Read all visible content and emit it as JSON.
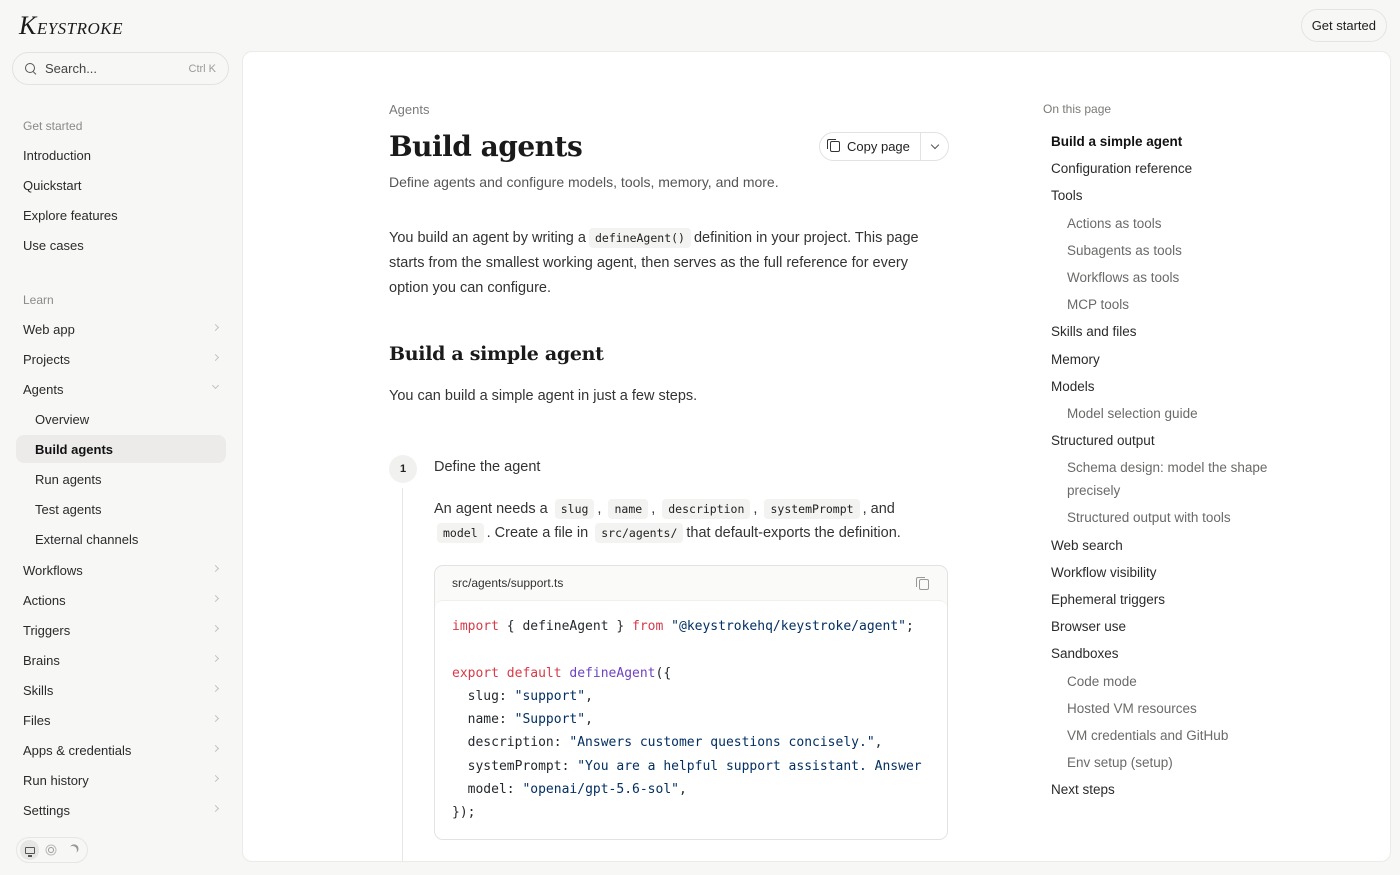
{
  "header": {
    "logo_initial": "K",
    "logo_rest": "EYSTROKE",
    "get_started": "Get started"
  },
  "sidebar": {
    "search_placeholder": "Search...",
    "search_shortcut": "Ctrl K",
    "section_get_started": "Get started",
    "get_started_items": [
      "Introduction",
      "Quickstart",
      "Explore features",
      "Use cases"
    ],
    "section_learn": "Learn",
    "learn_items": [
      "Web app",
      "Projects",
      "Agents"
    ],
    "agents_children": [
      "Overview",
      "Build agents",
      "Run agents",
      "Test agents",
      "External channels"
    ],
    "active_item": "Build agents",
    "more_items": [
      "Workflows",
      "Actions",
      "Triggers",
      "Brains",
      "Skills",
      "Files",
      "Apps & credentials",
      "Run history",
      "Settings"
    ],
    "theme_options": [
      "monitor-icon",
      "sun-icon",
      "moon-icon"
    ],
    "theme_selected": "monitor-icon"
  },
  "page": {
    "breadcrumb": "Agents",
    "title": "Build agents",
    "copy_page_label": "Copy page",
    "subtitle": "Define agents and configure models, tools, memory, and more.",
    "intro_before": "You build an agent by writing a",
    "intro_code": "defineAgent()",
    "intro_after": "definition in your project. This page starts from the smallest working agent, then serves as the full reference for every option you can configure.",
    "h2_simple": "Build a simple agent",
    "simple_para": "You can build a simple agent in just a few steps.",
    "step1": {
      "number": "1",
      "title": "Define the agent",
      "t1": "An agent needs a",
      "c_slug": "slug",
      "sep1": ",",
      "c_name": "name",
      "sep2": ",",
      "c_description": "description",
      "sep3": ",",
      "c_systemPrompt": "systemPrompt",
      "t2": ", and",
      "c_model": "model",
      "t3": ". Create a file in",
      "c_path": "src/agents/",
      "t4": "that default-exports the definition."
    },
    "code": {
      "filename": "src/agents/support.ts",
      "l1_kw1": "import",
      "l1_mid": " { defineAgent } ",
      "l1_kw2": "from",
      "l1_str": " \"@keystrokehq/keystroke/agent\"",
      "l1_end": ";",
      "l3_kw": "export default",
      "l3_fn": " defineAgent",
      "l3_end": "({",
      "l4_key": "  slug: ",
      "l4_val": "\"support\"",
      "l5_key": "  name: ",
      "l5_val": "\"Support\"",
      "l6_key": "  description: ",
      "l6_val": "\"Answers customer questions concisely.\"",
      "l7_key": "  systemPrompt: ",
      "l7_val": "\"You are a helpful support assistant. Answer",
      "l8_key": "  model: ",
      "l8_val": "\"openai/gpt-5.6-sol\"",
      "comma": ",",
      "l9": "});"
    }
  },
  "toc": {
    "label": "On this page",
    "active": "Build a simple agent",
    "items": [
      {
        "text": "Build a simple agent",
        "level": 1
      },
      {
        "text": "Configuration reference",
        "level": 1
      },
      {
        "text": "Tools",
        "level": 1
      },
      {
        "text": "Actions as tools",
        "level": 2
      },
      {
        "text": "Subagents as tools",
        "level": 2
      },
      {
        "text": "Workflows as tools",
        "level": 2
      },
      {
        "text": "MCP tools",
        "level": 2
      },
      {
        "text": "Skills and files",
        "level": 1
      },
      {
        "text": "Memory",
        "level": 1
      },
      {
        "text": "Models",
        "level": 1
      },
      {
        "text": "Model selection guide",
        "level": 2
      },
      {
        "text": "Structured output",
        "level": 1
      },
      {
        "text": "Schema design: model the shape precisely",
        "level": 2
      },
      {
        "text": "Structured output with tools",
        "level": 2
      },
      {
        "text": "Web search",
        "level": 1
      },
      {
        "text": "Workflow visibility",
        "level": 1
      },
      {
        "text": "Ephemeral triggers",
        "level": 1
      },
      {
        "text": "Browser use",
        "level": 1
      },
      {
        "text": "Sandboxes",
        "level": 1
      },
      {
        "text": "Code mode",
        "level": 2
      },
      {
        "text": "Hosted VM resources",
        "level": 2
      },
      {
        "text": "VM credentials and GitHub",
        "level": 2
      },
      {
        "text": "Env setup (setup)",
        "level": 2
      },
      {
        "text": "Next steps",
        "level": 1
      }
    ]
  }
}
